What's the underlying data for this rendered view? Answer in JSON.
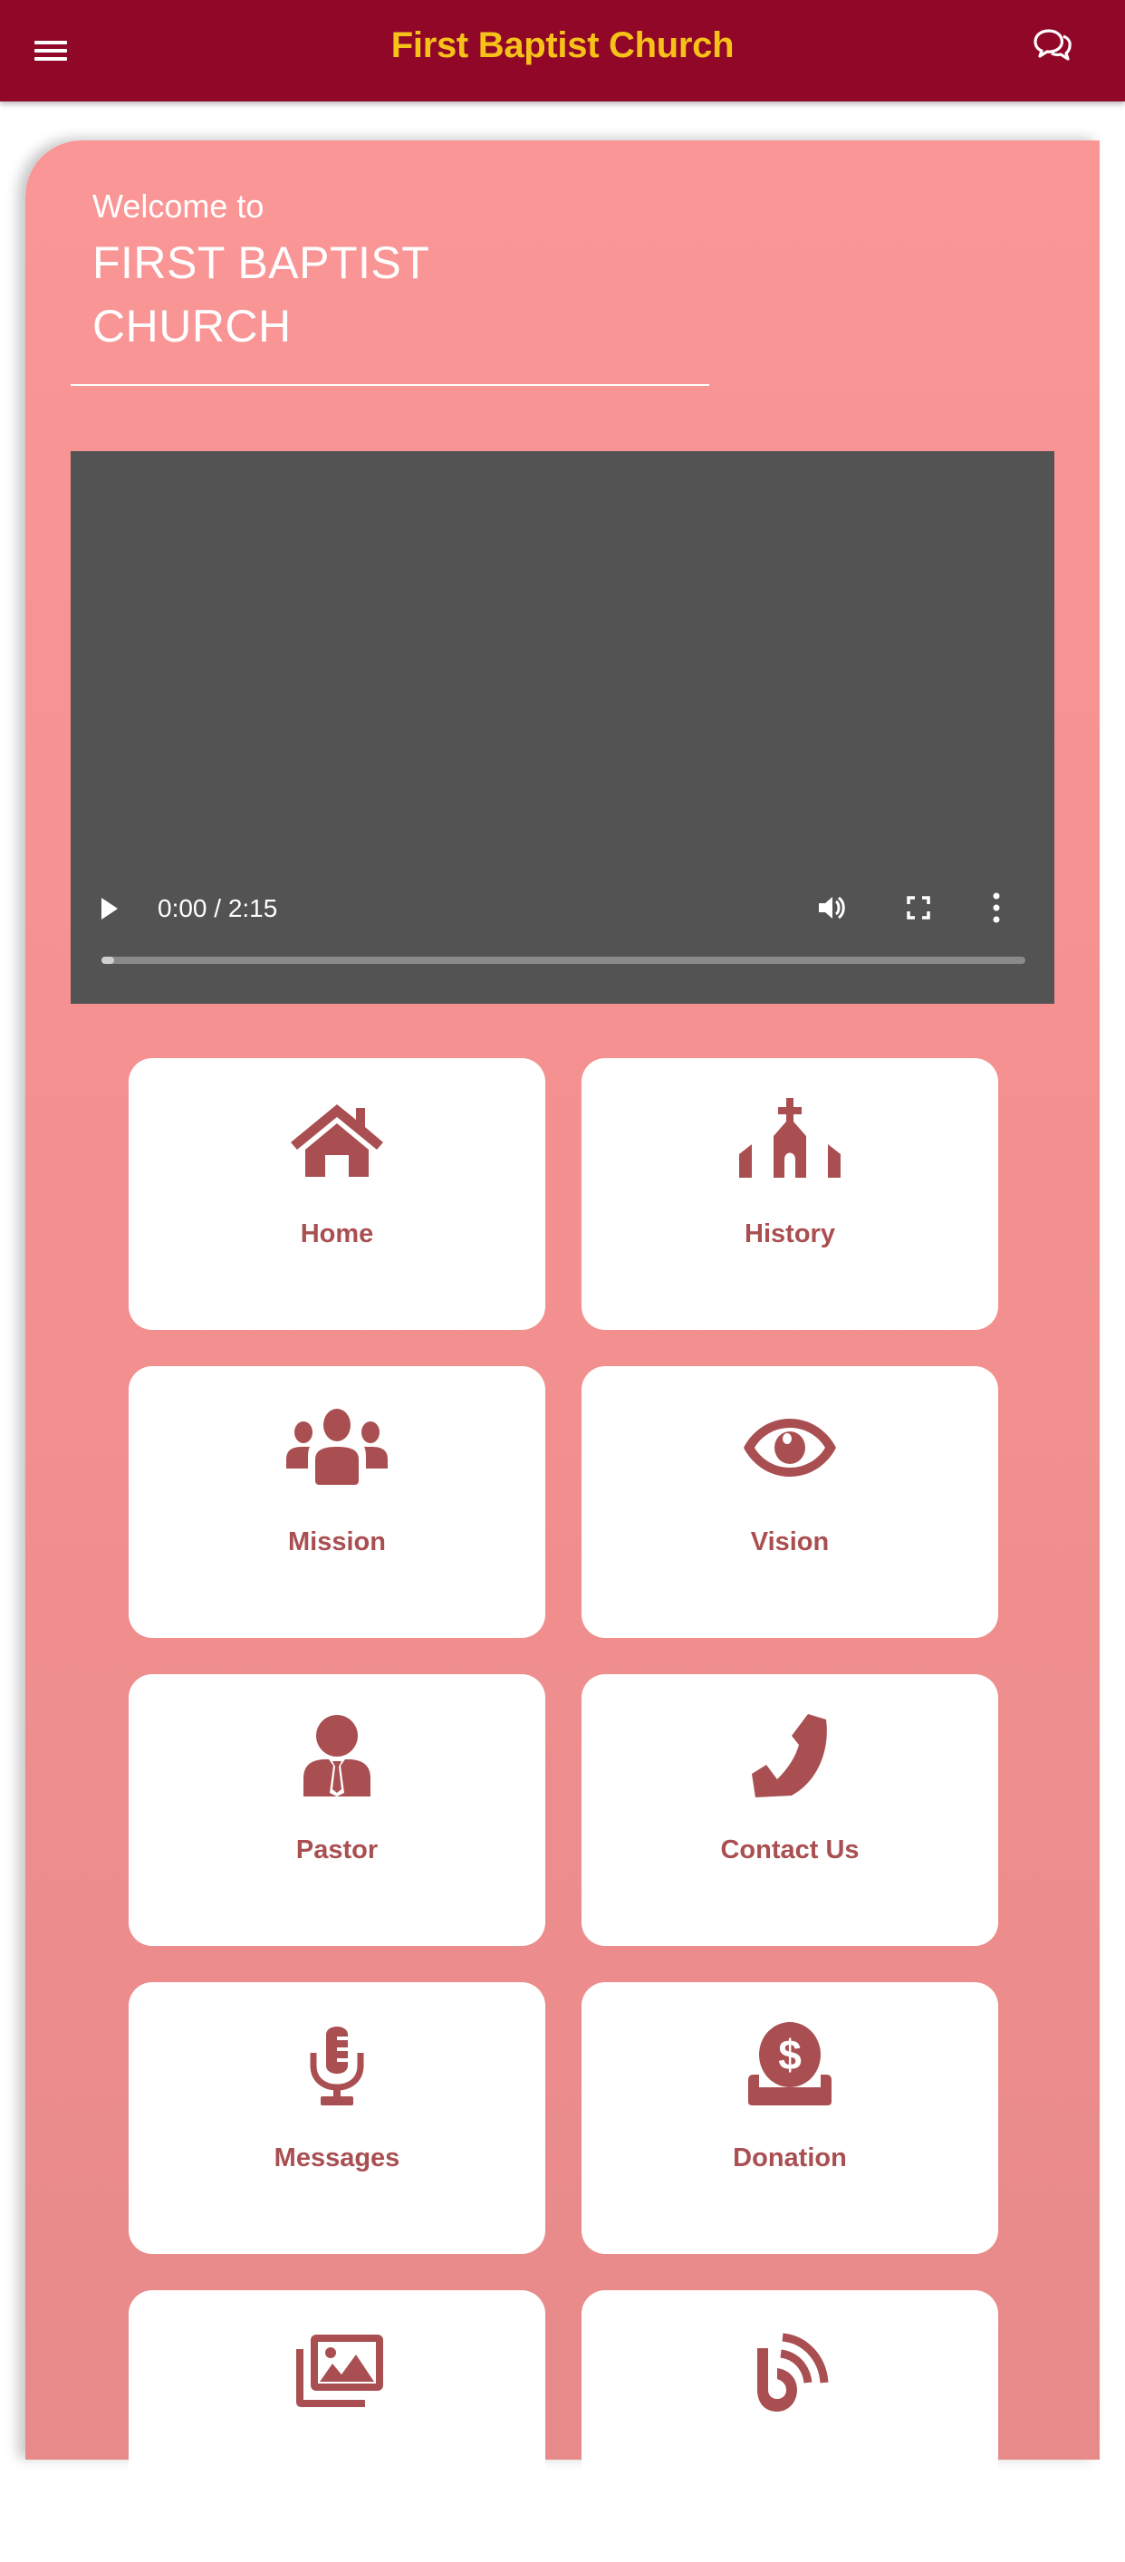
{
  "appbar": {
    "title": "First Baptist Church",
    "menu_icon": "hamburger-menu-icon",
    "chat_icon": "chat-bubbles-icon",
    "background_color": "#910728",
    "title_color": "#F6C21A"
  },
  "hero": {
    "welcome": "Welcome to",
    "church_name_line1": "FIRST BAPTIST",
    "church_name_line2": "CHURCH"
  },
  "video": {
    "current_time": "0:00",
    "duration": "2:15",
    "time_display": "0:00 / 2:15",
    "progress_percent": 0,
    "controls": [
      "play-icon",
      "volume-icon",
      "fullscreen-icon",
      "more-vertical-icon"
    ]
  },
  "menu": {
    "accent_color": "#A94F51",
    "items": [
      {
        "label": "Home",
        "icon": "home-icon"
      },
      {
        "label": "History",
        "icon": "church-icon"
      },
      {
        "label": "Mission",
        "icon": "users-icon"
      },
      {
        "label": "Vision",
        "icon": "eye-icon"
      },
      {
        "label": "Pastor",
        "icon": "pastor-icon"
      },
      {
        "label": "Contact Us",
        "icon": "phone-icon"
      },
      {
        "label": "Messages",
        "icon": "microphone-icon"
      },
      {
        "label": "Donation",
        "icon": "donation-icon"
      },
      {
        "label": "",
        "icon": "gallery-icon"
      },
      {
        "label": "",
        "icon": "blog-icon"
      }
    ]
  }
}
